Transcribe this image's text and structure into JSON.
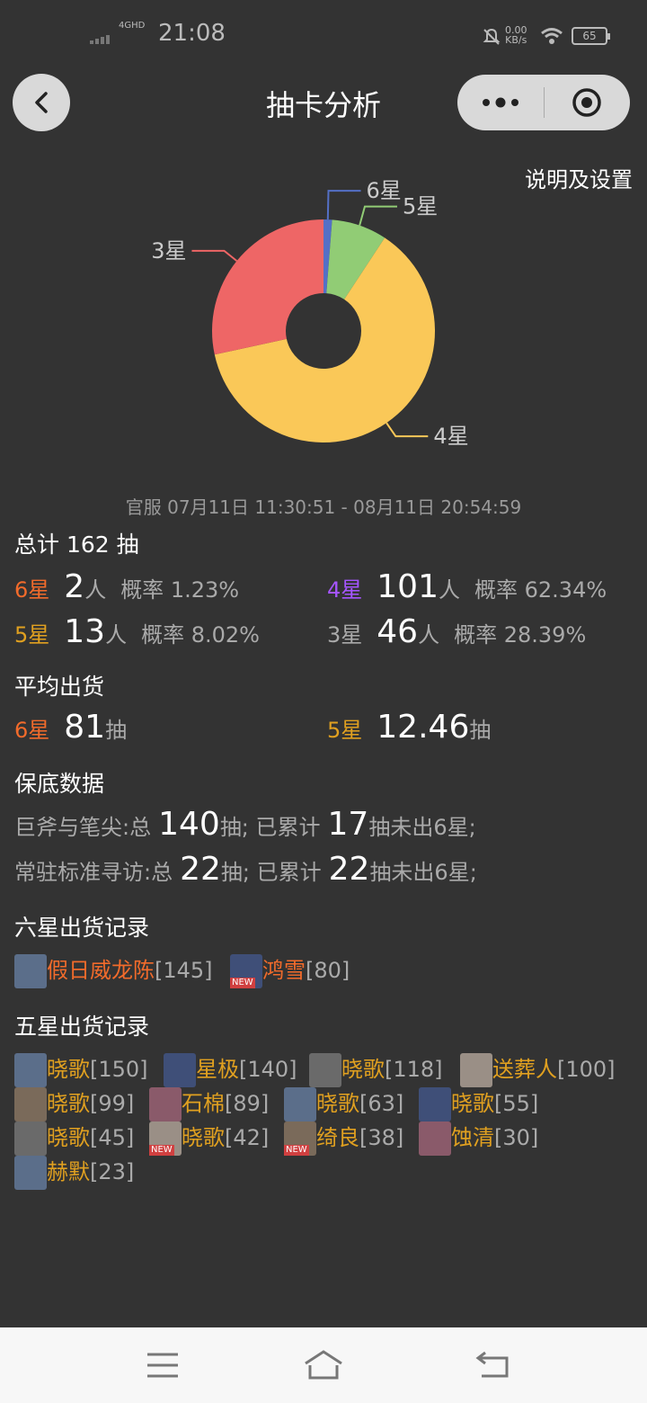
{
  "status": {
    "time": "21:08",
    "network": "4GHD",
    "speed_value": "0.00",
    "speed_unit": "KB/s",
    "battery": "65"
  },
  "header": {
    "title": "抽卡分析",
    "settings_link": "说明及设置"
  },
  "colors": {
    "six": "#5470c6",
    "five": "#91cc75",
    "four": "#fac858",
    "three": "#ee6666",
    "accent6": "#f26b2b",
    "accent5": "#e0a020",
    "accent4": "#a555ff"
  },
  "chart_data": {
    "type": "pie",
    "labels": [
      "6星",
      "5星",
      "4星",
      "3星"
    ],
    "values": [
      2,
      13,
      101,
      46
    ],
    "colors": [
      "#5470c6",
      "#91cc75",
      "#fac858",
      "#ee6666"
    ]
  },
  "date_range": "官服  07月11日 11:30:51  -  08月11日 20:54:59",
  "summary": {
    "total_label": "总计 162 抽",
    "unit_person": "人",
    "rate_label": "概率",
    "six": {
      "label": "6星",
      "count": "2",
      "rate": "1.23%"
    },
    "four": {
      "label": "4星",
      "count": "101",
      "rate": "62.34%"
    },
    "five": {
      "label": "5星",
      "count": "13",
      "rate": "8.02%"
    },
    "three": {
      "label": "3星",
      "count": "46",
      "rate": "28.39%"
    }
  },
  "average": {
    "title": "平均出货",
    "unit": "抽",
    "six": {
      "label": "6星",
      "value": "81"
    },
    "five": {
      "label": "5星",
      "value": "12.46"
    }
  },
  "pity": {
    "title": "保底数据",
    "rows": [
      {
        "pool": "巨斧与笔尖:总",
        "total": "140",
        "mid": "抽; 已累计",
        "current": "17",
        "tail": "抽未出6星;"
      },
      {
        "pool": "常驻标准寻访:总",
        "total": "22",
        "mid": "抽; 已累计",
        "current": "22",
        "tail": "抽未出6星;"
      }
    ]
  },
  "six_records": {
    "title": "六星出货记录",
    "items": [
      {
        "name": "假日威龙陈",
        "count": "[145]",
        "new": ""
      },
      {
        "name": "鸿雪",
        "count": "[80]",
        "new": "NEW"
      }
    ]
  },
  "five_records": {
    "title": "五星出货记录",
    "items": [
      {
        "name": "晓歌",
        "count": "[150]",
        "new": ""
      },
      {
        "name": "星极",
        "count": "[140]",
        "new": ""
      },
      {
        "name": "晓歌",
        "count": "[118]",
        "new": ""
      },
      {
        "name": "送葬人",
        "count": "[100]",
        "new": ""
      },
      {
        "name": "晓歌",
        "count": "[99]",
        "new": ""
      },
      {
        "name": "石棉",
        "count": "[89]",
        "new": ""
      },
      {
        "name": "晓歌",
        "count": "[63]",
        "new": ""
      },
      {
        "name": "晓歌",
        "count": "[55]",
        "new": ""
      },
      {
        "name": "晓歌",
        "count": "[45]",
        "new": ""
      },
      {
        "name": "晓歌",
        "count": "[42]",
        "new": "NEW"
      },
      {
        "name": "绮良",
        "count": "[38]",
        "new": "NEW"
      },
      {
        "name": "蚀清",
        "count": "[30]",
        "new": ""
      },
      {
        "name": "赫默",
        "count": "[23]",
        "new": ""
      }
    ]
  }
}
